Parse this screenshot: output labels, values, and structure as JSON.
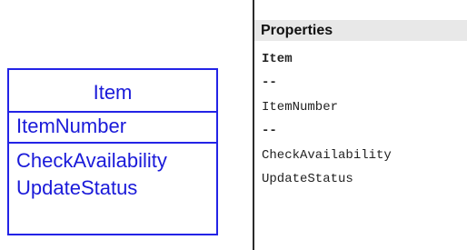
{
  "uml_class": {
    "name": "Item",
    "attributes": [
      "ItemNumber"
    ],
    "operations": [
      "CheckAvailability",
      "UpdateStatus"
    ],
    "color": "#2323e6"
  },
  "properties": {
    "header": "Properties",
    "lines": [
      "Item",
      "--",
      "ItemNumber",
      "--",
      "CheckAvailability",
      "UpdateStatus"
    ]
  }
}
